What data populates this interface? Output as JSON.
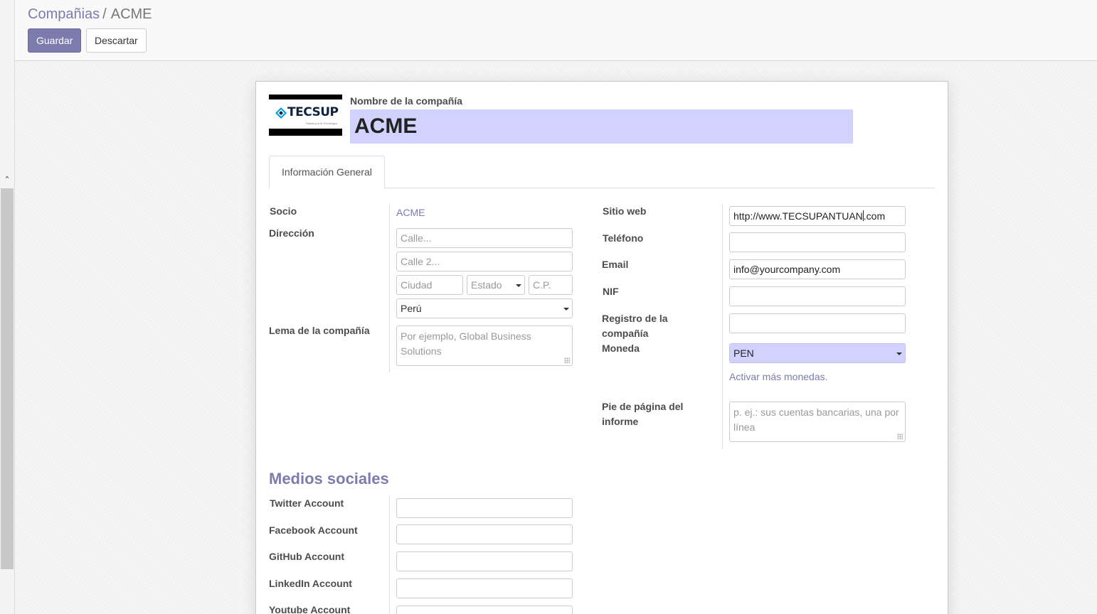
{
  "breadcrumb": {
    "parent": "Compañias",
    "separator": "/",
    "current": "ACME"
  },
  "toolbar": {
    "save_label": "Guardar",
    "discard_label": "Descartar"
  },
  "logo": {
    "text": "TECSUP",
    "tagline": "Pasión por la Tecnología"
  },
  "company": {
    "name_label": "Nombre de la compañía",
    "name_value": "ACME"
  },
  "tabs": [
    {
      "label": "Información General",
      "active": true
    }
  ],
  "left": {
    "partner_label": "Socio",
    "partner_value": "ACME",
    "address_label": "Dirección",
    "street_placeholder": "Calle...",
    "street2_placeholder": "Calle 2...",
    "city_placeholder": "Ciudad",
    "state_placeholder": "Estado",
    "zip_placeholder": "C.P.",
    "country_value": "Perú",
    "tagline_label": "Lema de la compañía",
    "tagline_placeholder": "Por ejemplo, Global Business Solutions"
  },
  "right": {
    "website_label": "Sitio web",
    "website_value_a": "http://www.TECSUPANTUAN",
    "website_value_b": ".com",
    "phone_label": "Teléfono",
    "phone_value": "",
    "email_label": "Email",
    "email_value": "info@yourcompany.com",
    "vat_label": "NIF",
    "vat_value": "",
    "registry_label": "Registro de la compañía",
    "registry_value": "",
    "currency_label": "Moneda",
    "currency_value": "PEN",
    "currency_link": "Activar más monedas.",
    "footer_label": "Pie de página del informe",
    "footer_placeholder": "p. ej.: sus cuentas bancarias, una por línea"
  },
  "social": {
    "title": "Medios sociales",
    "twitter_label": "Twitter Account",
    "facebook_label": "Facebook Account",
    "github_label": "GitHub Account",
    "linkedin_label": "LinkedIn Account",
    "youtube_label": "Youtube Account"
  },
  "colors": {
    "accent": "#7c7bad",
    "required_bg": "#d2d2ff"
  },
  "icons": [
    "chevron-up-icon",
    "caret-down-icon",
    "resize-grip-icon"
  ]
}
